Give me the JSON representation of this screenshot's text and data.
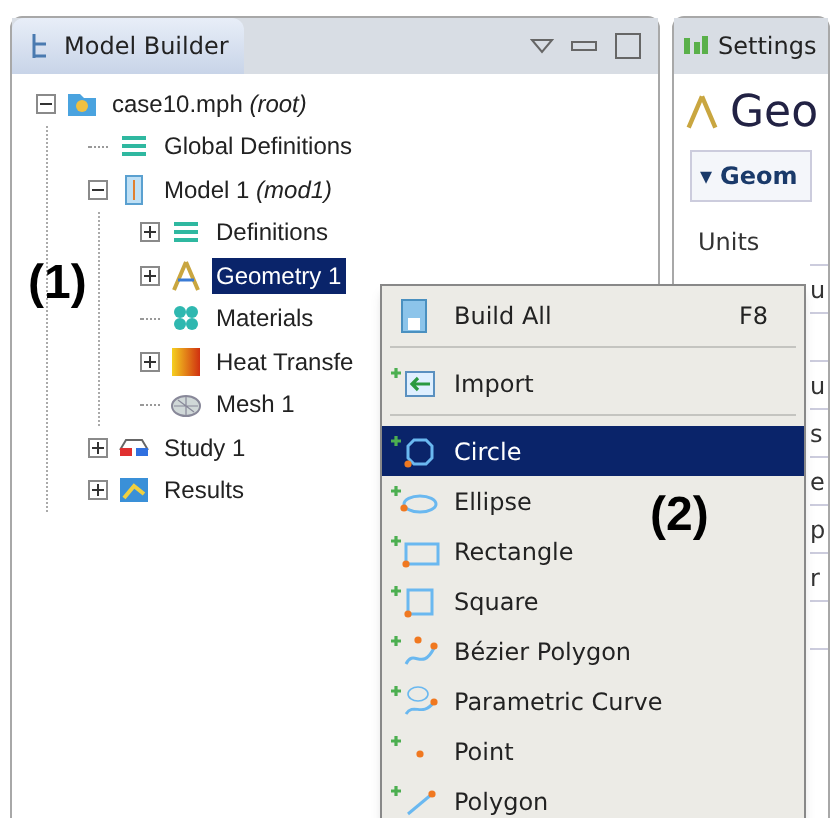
{
  "model_builder": {
    "title": "Model Builder",
    "tree": [
      {
        "label": "case10.mph",
        "tag": "(root)",
        "kind": "file",
        "expanded": true,
        "selected": false,
        "children": [
          {
            "label": "Global Definitions",
            "kind": "list",
            "selected": false
          },
          {
            "label": "Model 1",
            "tag": "(mod1)",
            "kind": "model",
            "expanded": true,
            "selected": false,
            "children": [
              {
                "label": "Definitions",
                "kind": "list",
                "expanded": false,
                "selected": false
              },
              {
                "label": "Geometry 1",
                "kind": "geometry",
                "expanded": false,
                "selected": true
              },
              {
                "label": "Materials",
                "kind": "materials",
                "selected": false
              },
              {
                "label": "Heat Transfe",
                "kind": "heat",
                "expanded": false,
                "selected": false
              },
              {
                "label": "Mesh 1",
                "kind": "mesh",
                "selected": false
              }
            ]
          },
          {
            "label": "Study 1",
            "kind": "study",
            "expanded": false,
            "selected": false
          },
          {
            "label": "Results",
            "kind": "results",
            "expanded": false,
            "selected": false
          }
        ]
      }
    ]
  },
  "settings": {
    "title": "Settings",
    "heading": "Geo",
    "section_toggle": "▾",
    "section": "Geom",
    "rows": [
      "Units",
      "u",
      "",
      "u",
      "s",
      "e",
      "p",
      "r",
      ""
    ]
  },
  "annotations": [
    "(1)",
    "(2)"
  ],
  "context_menu": {
    "items": [
      {
        "kind": "command",
        "label": "Build All",
        "shortcut": "F8",
        "selected": false
      },
      {
        "kind": "separator"
      },
      {
        "kind": "command",
        "label": "Import",
        "selected": false
      },
      {
        "kind": "separator"
      },
      {
        "kind": "command",
        "label": "Circle",
        "selected": true
      },
      {
        "kind": "command",
        "label": "Ellipse",
        "selected": false
      },
      {
        "kind": "command",
        "label": "Rectangle",
        "selected": false
      },
      {
        "kind": "command",
        "label": "Square",
        "selected": false
      },
      {
        "kind": "command",
        "label": "Bézier Polygon",
        "selected": false
      },
      {
        "kind": "command",
        "label": "Parametric Curve",
        "selected": false
      },
      {
        "kind": "command",
        "label": "Point",
        "selected": false
      },
      {
        "kind": "command",
        "label": "Polygon",
        "selected": false
      }
    ]
  }
}
